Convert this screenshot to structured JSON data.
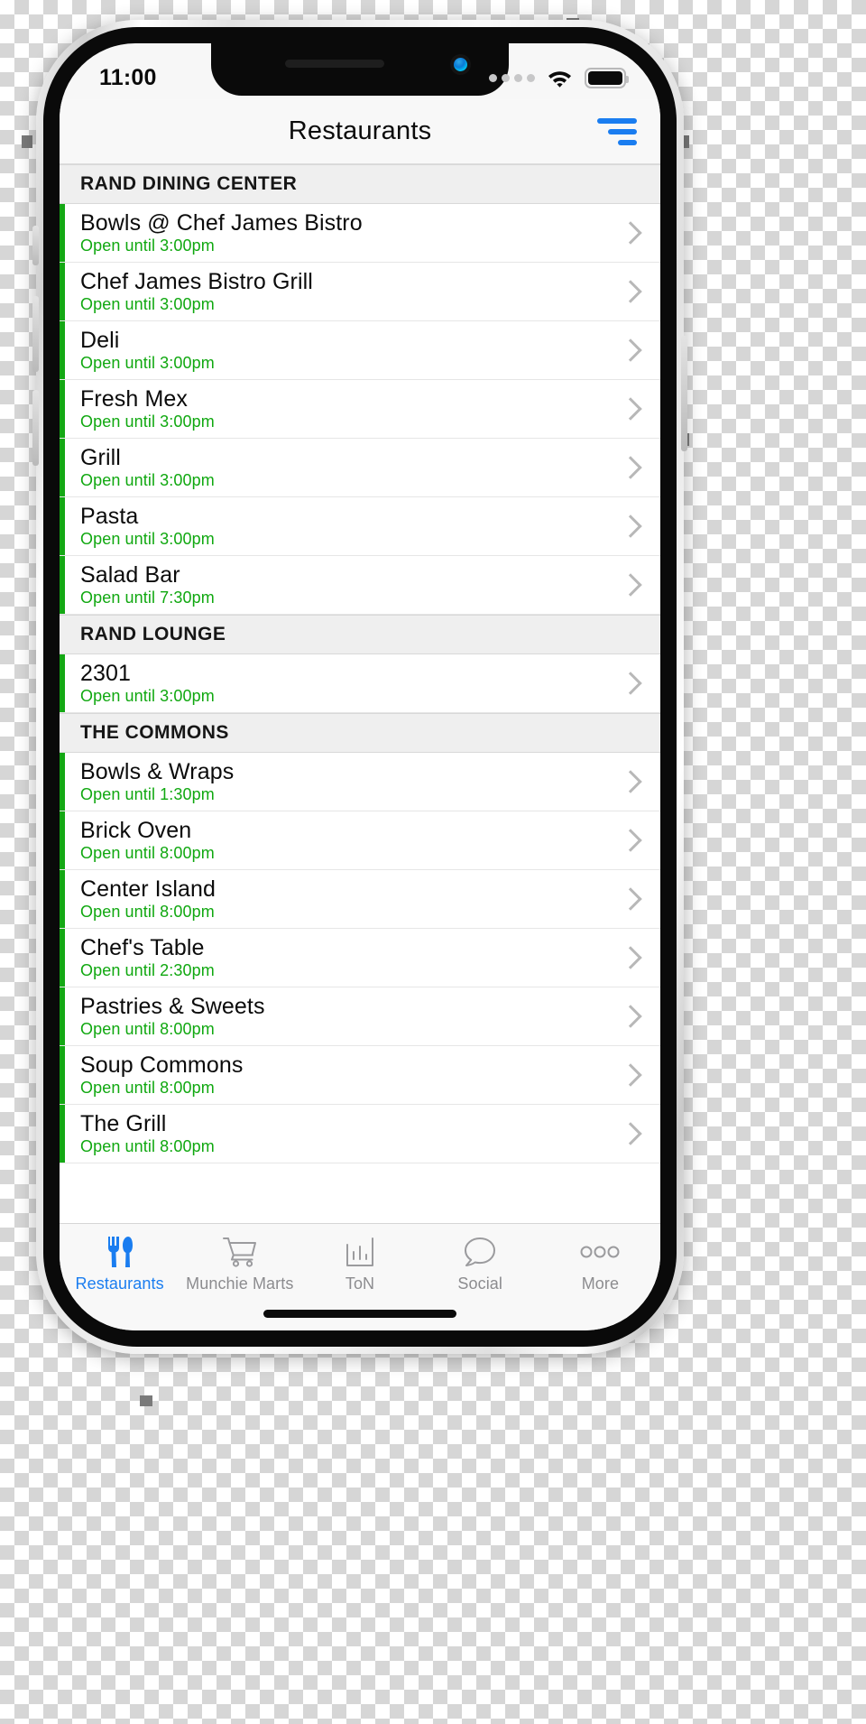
{
  "status_bar": {
    "time": "11:00",
    "signal_icon": "signal-dots-icon",
    "wifi_icon": "wifi-icon",
    "battery_icon": "battery-icon"
  },
  "nav_bar": {
    "title": "Restaurants",
    "filter_icon": "filter-sort-icon"
  },
  "colors": {
    "accent_blue": "#1a7df0",
    "open_green": "#10a810",
    "row_accent_green": "#14a814",
    "section_header_bg": "#efefef",
    "screen_bg": "#ffffff"
  },
  "sections": [
    {
      "title": "RAND DINING CENTER",
      "rows": [
        {
          "name": "Bowls @ Chef James Bistro",
          "status": "Open until 3:00pm"
        },
        {
          "name": "Chef James Bistro Grill",
          "status": "Open until 3:00pm"
        },
        {
          "name": "Deli",
          "status": "Open until 3:00pm"
        },
        {
          "name": "Fresh Mex",
          "status": "Open until 3:00pm"
        },
        {
          "name": "Grill",
          "status": "Open until 3:00pm"
        },
        {
          "name": "Pasta",
          "status": "Open until 3:00pm"
        },
        {
          "name": "Salad Bar",
          "status": "Open until 7:30pm"
        }
      ]
    },
    {
      "title": "RAND LOUNGE",
      "rows": [
        {
          "name": "2301",
          "status": "Open until 3:00pm"
        }
      ]
    },
    {
      "title": "THE COMMONS",
      "rows": [
        {
          "name": "Bowls & Wraps",
          "status": "Open until 1:30pm"
        },
        {
          "name": "Brick Oven",
          "status": "Open until 8:00pm"
        },
        {
          "name": "Center Island",
          "status": "Open until 8:00pm"
        },
        {
          "name": "Chef's Table",
          "status": "Open until 2:30pm"
        },
        {
          "name": "Pastries & Sweets",
          "status": "Open until 8:00pm"
        },
        {
          "name": "Soup Commons",
          "status": "Open until 8:00pm"
        },
        {
          "name": "The Grill",
          "status": "Open until 8:00pm"
        }
      ]
    }
  ],
  "tab_bar": {
    "items": [
      {
        "label": "Restaurants",
        "icon": "fork-knife-icon",
        "active": true
      },
      {
        "label": "Munchie Marts",
        "icon": "shopping-cart-icon",
        "active": false
      },
      {
        "label": "ToN",
        "icon": "bar-chart-icon",
        "active": false
      },
      {
        "label": "Social",
        "icon": "speech-bubble-icon",
        "active": false
      },
      {
        "label": "More",
        "icon": "ellipsis-icon",
        "active": false
      }
    ]
  }
}
